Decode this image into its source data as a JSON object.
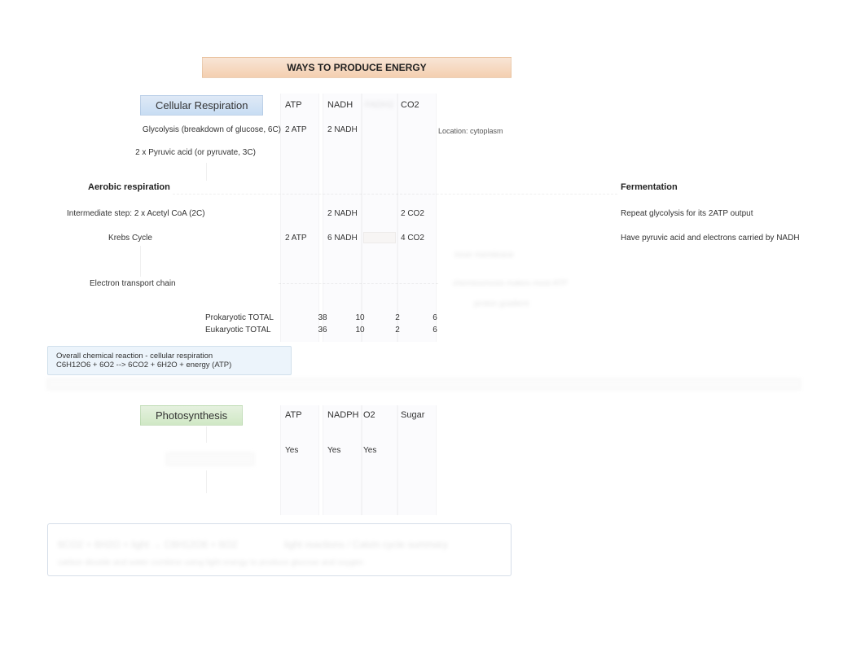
{
  "title": "WAYS TO PRODUCE ENERGY",
  "cellular": {
    "header": "Cellular Respiration",
    "cols": {
      "c1": "ATP",
      "c2": "NADH",
      "c3": "CO2",
      "c3_faded": "FADH2"
    },
    "glycolysis": {
      "label": "Glycolysis (breakdown of glucose, 6C)",
      "atp": "2 ATP",
      "nadh": "2 NADH",
      "note": "Location: cytoplasm"
    },
    "pyruvic": "2 x Pyruvic acid (or pyruvate, 3C)",
    "aerobic_hdr": "Aerobic respiration",
    "fermentation_hdr": "Fermentation",
    "intermediate": {
      "label": "Intermediate step: 2 x Acetyl CoA (2C)",
      "nadh": "2 NADH",
      "co2": "2 CO2"
    },
    "krebs": {
      "label": "Krebs Cycle",
      "atp": "2 ATP",
      "nadh": "6 NADH",
      "co2": "4 CO2"
    },
    "etc": {
      "label": "Electron transport chain"
    },
    "ferm_note1": "Repeat glycolysis for its 2ATP output",
    "ferm_note2": "Have pyruvic acid and electrons carried by NADH",
    "totals": {
      "pro_label": "Prokaryotic TOTAL",
      "pro": {
        "a": "38",
        "b": "10",
        "c": "2",
        "d": "6"
      },
      "euk_label": "Eukaryotic TOTAL",
      "euk": {
        "a": "36",
        "b": "10",
        "c": "2",
        "d": "6"
      }
    },
    "eq1": "Overall chemical reaction - cellular respiration",
    "eq2": "C6H12O6 + 6O2 --> 6CO2 + 6H2O + energy (ATP)"
  },
  "photo": {
    "header": "Photosynthesis",
    "cols": {
      "c1": "ATP",
      "c2": "NADPH",
      "c3": "O2",
      "c4": "Sugar"
    },
    "row1": {
      "atp": "Yes",
      "nadph": "Yes",
      "o2": "Yes"
    }
  }
}
